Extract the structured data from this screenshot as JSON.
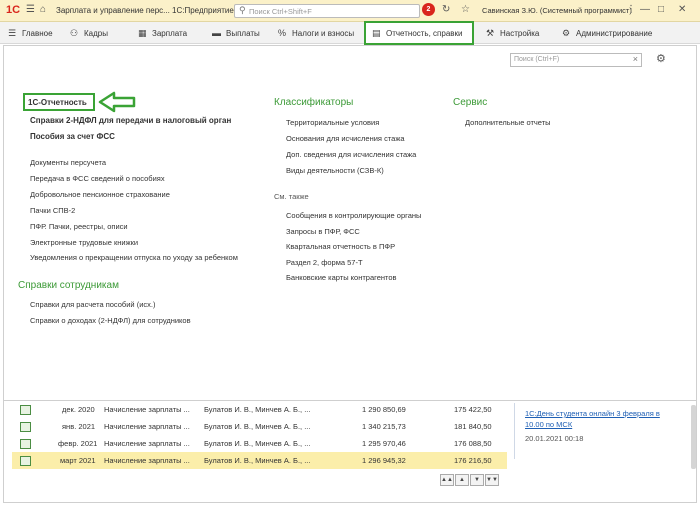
{
  "titlebar": {
    "logo": "1С",
    "title": "Зарплата и управление перс...  1С:Предприятие",
    "search_placeholder": "Поиск Ctrl+Shift+F",
    "notifications_count": "2",
    "user": "Савинская З.Ю. (Системный программист)"
  },
  "sections": [
    {
      "label": "Главное",
      "icon": "menu-icon"
    },
    {
      "label": "Кадры",
      "icon": "people-icon"
    },
    {
      "label": "Зарплата",
      "icon": "calculator-icon"
    },
    {
      "label": "Выплаты",
      "icon": "wallet-icon"
    },
    {
      "label": "Налоги и взносы",
      "icon": "percent-icon"
    },
    {
      "label": "Отчетность, справки",
      "icon": "report-icon",
      "active": true
    },
    {
      "label": "Настройка",
      "icon": "wrench-icon"
    },
    {
      "label": "Администрирование",
      "icon": "gear-icon"
    }
  ],
  "panel": {
    "search_placeholder": "Поиск (Ctrl+F)",
    "col1": {
      "header": "1С-Отчетность",
      "bold_links": [
        "Справки 2-НДФЛ для передачи в налоговый орган",
        "Пособия за счет ФСС"
      ],
      "links": [
        "Документы персучета",
        "Передача в ФСС сведений о пособиях",
        "Добровольное пенсионное страхование",
        "Пачки СПВ-2",
        "ПФР. Пачки, реестры, описи",
        "Электронные трудовые книжки",
        "Уведомления о прекращении отпуска по уходу за ребенком"
      ],
      "header2": "Справки сотрудникам",
      "links2": [
        "Справки для расчета пособий (исх.)",
        "Справки о доходах (2-НДФЛ) для сотрудников"
      ]
    },
    "col2": {
      "header": "Классификаторы",
      "links": [
        "Территориальные условия",
        "Основания для исчисления стажа",
        "Доп. сведения для исчисления стажа",
        "Виды деятельности (СЗВ-К)"
      ],
      "header2": "См. также",
      "links2": [
        "Сообщения в контролирующие органы",
        "Запросы в ПФР, ФСС",
        "Квартальная отчетность в ПФР",
        "Раздел 2, форма 57-Т",
        "Банковские карты контрагентов"
      ]
    },
    "col3": {
      "header": "Сервис",
      "links": [
        "Дополнительные отчеты"
      ]
    }
  },
  "table": {
    "rows": [
      {
        "month": "дек. 2020",
        "type": "Начисление зарплаты ...",
        "persons": "Булатов И. В., Минчев А. Б., ...",
        "sum": "1 290 850,69",
        "tax": "175 422,50"
      },
      {
        "month": "янв. 2021",
        "type": "Начисление зарплаты ...",
        "persons": "Булатов И. В., Минчев А. Б., ...",
        "sum": "1 340 215,73",
        "tax": "181 840,50"
      },
      {
        "month": "февр. 2021",
        "type": "Начисление зарплаты ...",
        "persons": "Булатов И. В., Минчев А. Б., ...",
        "sum": "1 295 970,46",
        "tax": "176 088,50"
      },
      {
        "month": "март 2021",
        "type": "Начисление зарплаты ...",
        "persons": "Булатов И. В., Минчев А. Б., ...",
        "sum": "1 296 945,32",
        "tax": "176 216,50",
        "selected": true
      }
    ]
  },
  "news": {
    "line1": "1С:День студента онлайн 3 февраля в",
    "line2": "10.00 по МСК",
    "date": "20.01.2021 00:18"
  },
  "colors": {
    "accent_green": "#3aa335",
    "title_bg": "#fbf1c9",
    "selected_row": "#fbeeaa"
  }
}
